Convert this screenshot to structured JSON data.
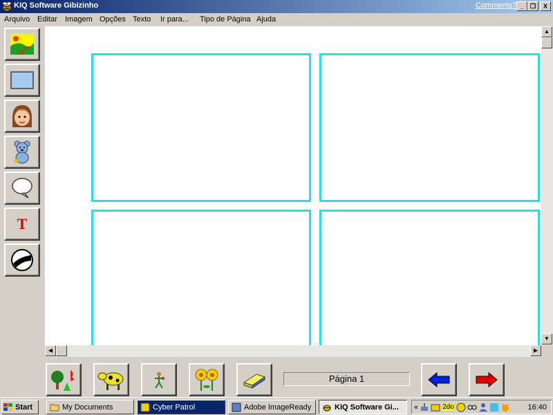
{
  "window": {
    "title": "KIQ Software Gibizinho",
    "comments_link": "Comments?",
    "minimize": "_",
    "restore": "❐",
    "close": "X"
  },
  "menu": [
    "Arquivo",
    "Editar",
    "Imagem",
    "Opções",
    "Texto",
    "Ir para...",
    "Tipo de Página",
    "Ajuda"
  ],
  "left_tools": [
    "scenery-tool",
    "rectangle-tool",
    "character-tool",
    "teddy-bear-tool",
    "speech-balloon-tool",
    "text-tool",
    "effects-tool"
  ],
  "left_tool_text": {
    "text_tool_label": "T"
  },
  "bottom_tools": [
    "trees-tool",
    "cow-tool",
    "small-figure-tool",
    "flowers-tool",
    "eraser-tool"
  ],
  "page_indicator": "Página 1",
  "taskbar": {
    "start": "Start",
    "tasks": [
      "My Documents",
      "Cyber Patrol",
      "Adobe ImageReady",
      "KIQ Software Gi..."
    ],
    "tray_chevron": "«",
    "tray_label": "2do",
    "clock": "16:40"
  },
  "colors": {
    "panel_border": "#22e3e3",
    "titlebar": "#0a246a",
    "face": "#d4d0c8"
  }
}
